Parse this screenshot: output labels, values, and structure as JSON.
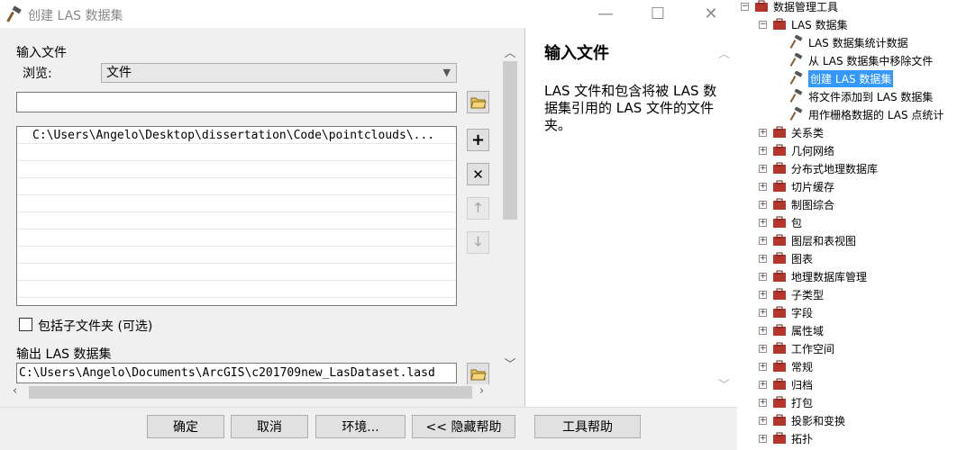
{
  "window": {
    "title": "创建 LAS 数据集",
    "minimize_icon": "—",
    "maximize_icon": "☐",
    "close_icon": "✕"
  },
  "form": {
    "input_files_label": "输入文件",
    "browse_label": "浏览:",
    "browse_value": "文件",
    "path_value": "",
    "file_list": [
      "C:\\Users\\Angelo\\Desktop\\dissertation\\Code\\pointclouds\\...",
      "",
      "",
      "",
      "",
      "",
      "",
      "",
      "",
      ""
    ],
    "include_subfolders_label": "包括子文件夹 (可选)",
    "output_label": "输出 LAS 数据集",
    "output_value": "C:\\Users\\Angelo\\Documents\\ArcGIS\\c201709new_LasDataset.lasd"
  },
  "side_buttons": {
    "add": "+",
    "remove": "✕",
    "up": "🡑",
    "down": "🡓"
  },
  "help": {
    "title": "输入文件",
    "text": "LAS 文件和包含将被 LAS 数据集引用的 LAS 文件的文件夹。"
  },
  "buttons": {
    "ok": "确定",
    "cancel": "取消",
    "env": "环境...",
    "hide_help": "<< 隐藏帮助",
    "tool_help": "工具帮助"
  },
  "tree": {
    "root": "数据管理工具",
    "las_dataset": "LAS 数据集",
    "las_tools": [
      "LAS 数据集统计数据",
      "从 LAS 数据集中移除文件",
      "创建 LAS 数据集",
      "将文件添加到 LAS 数据集",
      "用作栅格数据的 LAS 点统计"
    ],
    "toolsets": [
      "关系类",
      "几何网络",
      "分布式地理数据库",
      "切片缓存",
      "制图综合",
      "包",
      "图层和表视图",
      "图表",
      "地理数据库管理",
      "子类型",
      "字段",
      "属性域",
      "工作空间",
      "常规",
      "归档",
      "打包",
      "投影和变换",
      "拓扑"
    ],
    "expand_symbol": "+",
    "collapse_symbol": "−"
  },
  "colors": {
    "selection": "#3399ff",
    "toolbox_red": "#b5352c"
  }
}
